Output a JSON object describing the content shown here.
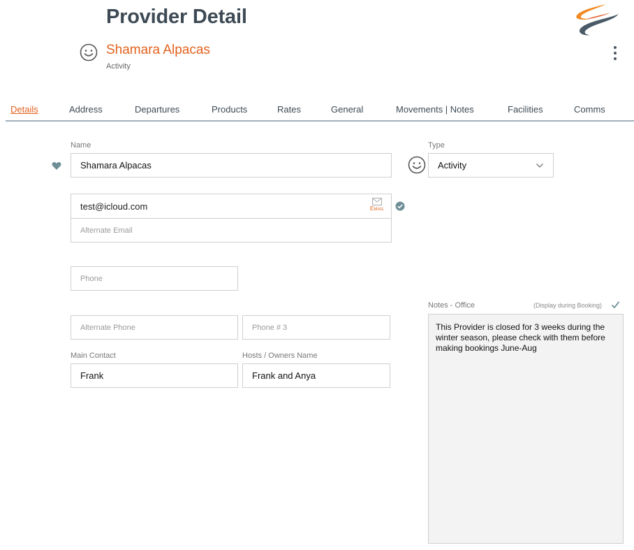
{
  "header": {
    "title": "Provider Detail",
    "provider_name": "Shamara Alpacas",
    "provider_type": "Activity",
    "logo": "swoosh-logo",
    "menu_icon": "kebab-menu-icon"
  },
  "tabs": [
    {
      "label": "Details",
      "active": true
    },
    {
      "label": "Address"
    },
    {
      "label": "Departures"
    },
    {
      "label": "Products"
    },
    {
      "label": "Rates"
    },
    {
      "label": "General"
    },
    {
      "label": "Movements | Notes"
    },
    {
      "label": "Facilities"
    },
    {
      "label": "Comms"
    }
  ],
  "form": {
    "name": {
      "label": "Name",
      "value": "Shamara Alpacas"
    },
    "type": {
      "label": "Type",
      "value": "Activity"
    },
    "email": {
      "value": "test@icloud.com",
      "badge": "Email"
    },
    "alternate_email": {
      "placeholder": "Alternate Email"
    },
    "phone": {
      "placeholder": "Phone"
    },
    "alternate_phone": {
      "placeholder": "Alternate Phone"
    },
    "phone3": {
      "placeholder": "Phone # 3"
    },
    "main_contact": {
      "label": "Main Contact",
      "value": "Frank"
    },
    "hosts": {
      "label": "Hosts / Owners Name",
      "value": "Frank and Anya"
    }
  },
  "notes": {
    "label": "Notes - Office",
    "hint": "(Display during Booking)",
    "text": "This Provider is closed for 3 weeks during the winter season, please check with them before making bookings June-Aug"
  },
  "colors": {
    "accent": "#e2621e",
    "title": "#3d4a55",
    "icon_teal": "#6f8f97"
  }
}
